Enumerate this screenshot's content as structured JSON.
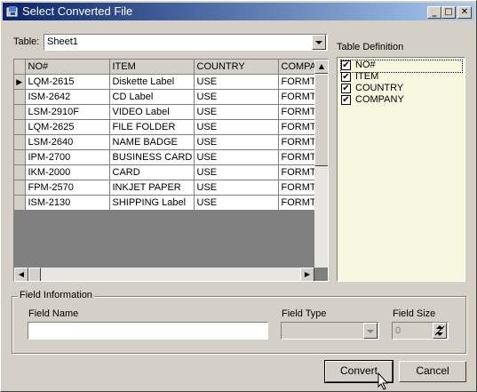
{
  "window": {
    "title": "Select Converted File"
  },
  "table_selector": {
    "label": "Table:",
    "value": "Sheet1"
  },
  "grid": {
    "columns": [
      "NO#",
      "ITEM",
      "COUNTRY",
      "COMPA"
    ],
    "rows": [
      [
        "LQM-2615",
        "Diskette Label",
        "USE",
        "FORMT"
      ],
      [
        "ISM-2642",
        "CD Label",
        "USE",
        "FORMT"
      ],
      [
        "LSM-2910F",
        "VIDEO Label",
        "USE",
        "FORMT"
      ],
      [
        "LQM-2625",
        "FILE FOLDER",
        "USE",
        "FORMT"
      ],
      [
        "LSM-2640",
        "NAME BADGE",
        "USE",
        "FORMT"
      ],
      [
        "IPM-2700",
        "BUSINESS CARD",
        "USE",
        "FORMT"
      ],
      [
        "IKM-2000",
        "CARD",
        "USE",
        "FORMT"
      ],
      [
        "FPM-2570",
        "INKJET PAPER",
        "USE",
        "FORMT"
      ],
      [
        "ISM-2130",
        "SHIPPING Label",
        "USE",
        "FORMT"
      ]
    ],
    "current_row_marker": "▶"
  },
  "table_definition": {
    "label": "Table Definition",
    "fields": [
      {
        "name": "NO#",
        "checked": true
      },
      {
        "name": "ITEM",
        "checked": true
      },
      {
        "name": "COUNTRY",
        "checked": true
      },
      {
        "name": "COMPANY",
        "checked": true
      }
    ],
    "check_glyph": "✔"
  },
  "field_information": {
    "group_label": "Field Information",
    "field_name_label": "Field Name",
    "field_name_value": "",
    "field_type_label": "Field Type",
    "field_type_value": "",
    "field_size_label": "Field Size",
    "field_size_value": "0"
  },
  "buttons": {
    "convert": "Convert",
    "cancel": "Cancel"
  },
  "title_buttons": {
    "minimize": "_",
    "maximize": "□",
    "close": "✕"
  },
  "icons": {
    "app": "app-icon",
    "dropdown": "chevron-down-icon",
    "spin": "spin-icon",
    "scroll_up": "arrow-up-icon",
    "scroll_down": "arrow-down-icon",
    "scroll_left": "arrow-left-icon",
    "scroll_right": "arrow-right-icon",
    "cursor": "mouse-cursor-icon"
  },
  "colors": {
    "titlebar_start": "#0a246a",
    "titlebar_end": "#a6caf0",
    "definition_bg": "#f8f8e0",
    "face": "#d4d0c8"
  }
}
